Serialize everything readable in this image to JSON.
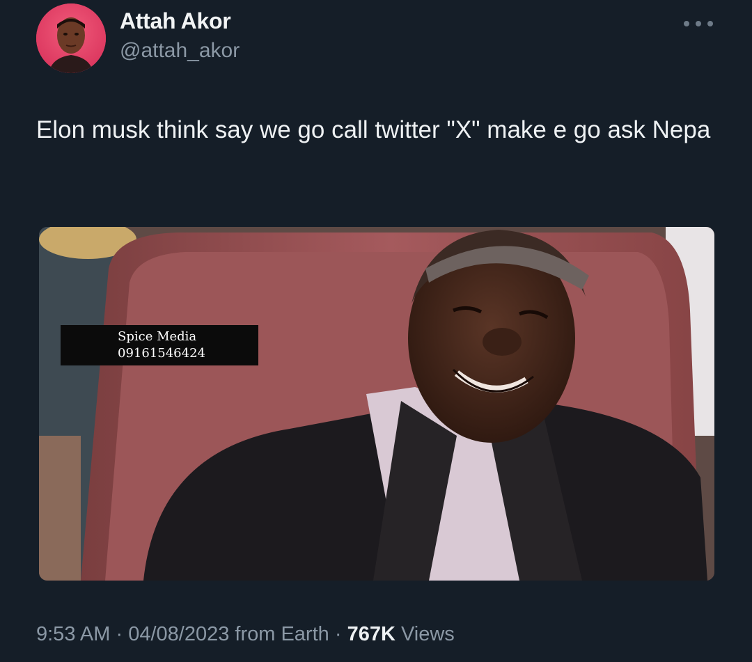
{
  "author": {
    "display_name": "Attah Akor",
    "handle": "@attah_akor",
    "avatar_icon": "profile-photo"
  },
  "tweet": {
    "text": "Elon musk think say we go call twitter \"X\" make e go ask Nepa"
  },
  "media": {
    "watermark_line1": "Spice Media",
    "watermark_line2": "09161546424"
  },
  "meta": {
    "time": "9:53 AM",
    "separator": " · ",
    "date": "04/08/2023",
    "source": "from Earth",
    "views_count": "767K",
    "views_label": "Views"
  },
  "colors": {
    "background": "#151e28",
    "text_primary": "#eef1f3",
    "text_secondary": "#8b98a5"
  }
}
